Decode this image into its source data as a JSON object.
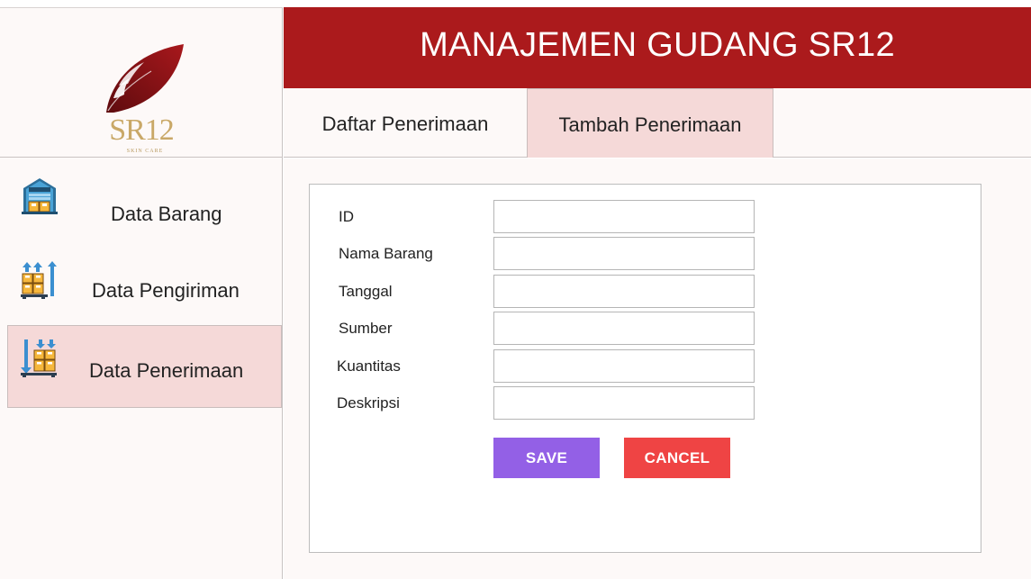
{
  "header": {
    "title": "MANAJEMEN GUDANG SR12"
  },
  "logo": {
    "brand_text": "SR12",
    "sub_text": "SKIN CARE",
    "icon": "leaf-logo-icon"
  },
  "sidebar": {
    "items": [
      {
        "label": "Data Barang",
        "icon": "warehouse-icon",
        "active": false
      },
      {
        "label": "Data Pengiriman",
        "icon": "boxes-up-arrows-icon",
        "active": false
      },
      {
        "label": "Data Penerimaan",
        "icon": "boxes-down-arrows-icon",
        "active": true
      }
    ]
  },
  "tabs": [
    {
      "label": "Daftar Penerimaan",
      "active": false
    },
    {
      "label": "Tambah Penerimaan",
      "active": true
    }
  ],
  "form": {
    "fields": [
      {
        "label": "ID",
        "value": "",
        "placeholder": ""
      },
      {
        "label": "Nama Barang",
        "value": "",
        "placeholder": ""
      },
      {
        "label": "Tanggal",
        "value": "",
        "placeholder": ""
      },
      {
        "label": "Sumber",
        "value": "",
        "placeholder": ""
      },
      {
        "label": "Kuantitas",
        "value": "",
        "placeholder": ""
      },
      {
        "label": "Deskripsi",
        "value": "",
        "placeholder": ""
      }
    ],
    "save_label": "SAVE",
    "cancel_label": "CANCEL"
  },
  "colors": {
    "header_bg": "#ab1a1c",
    "active_bg": "#f5d9d8",
    "save_button": "#9360e6",
    "cancel_button": "#ef4444",
    "logo_gold": "#c9a867",
    "logo_red": "#8b1216"
  }
}
